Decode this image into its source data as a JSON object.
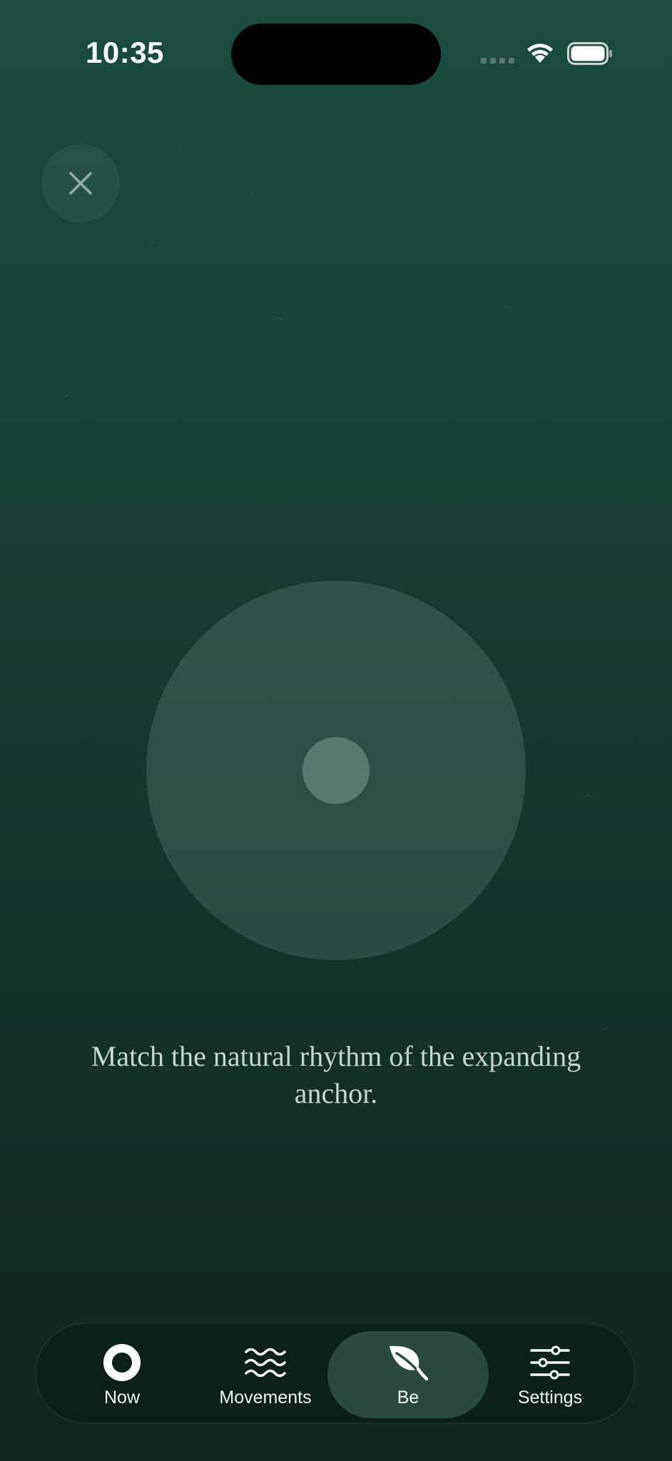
{
  "status_bar": {
    "time": "10:35"
  },
  "close_button": {
    "icon": "close-icon"
  },
  "anchor": {
    "description_text": "Match the natural rhythm of the expanding anchor."
  },
  "tab_bar": {
    "items": [
      {
        "label": "Now",
        "icon": "ring-icon",
        "active": false
      },
      {
        "label": "Movements",
        "icon": "waves-icon",
        "active": false
      },
      {
        "label": "Be",
        "icon": "leaf-icon",
        "active": true
      },
      {
        "label": "Settings",
        "icon": "sliders-icon",
        "active": false
      }
    ]
  },
  "colors": {
    "background_top": "#1d4b41",
    "background_bottom": "#0f2620",
    "active_tab": "#2b4841",
    "text_primary": "#c6d6cf"
  }
}
